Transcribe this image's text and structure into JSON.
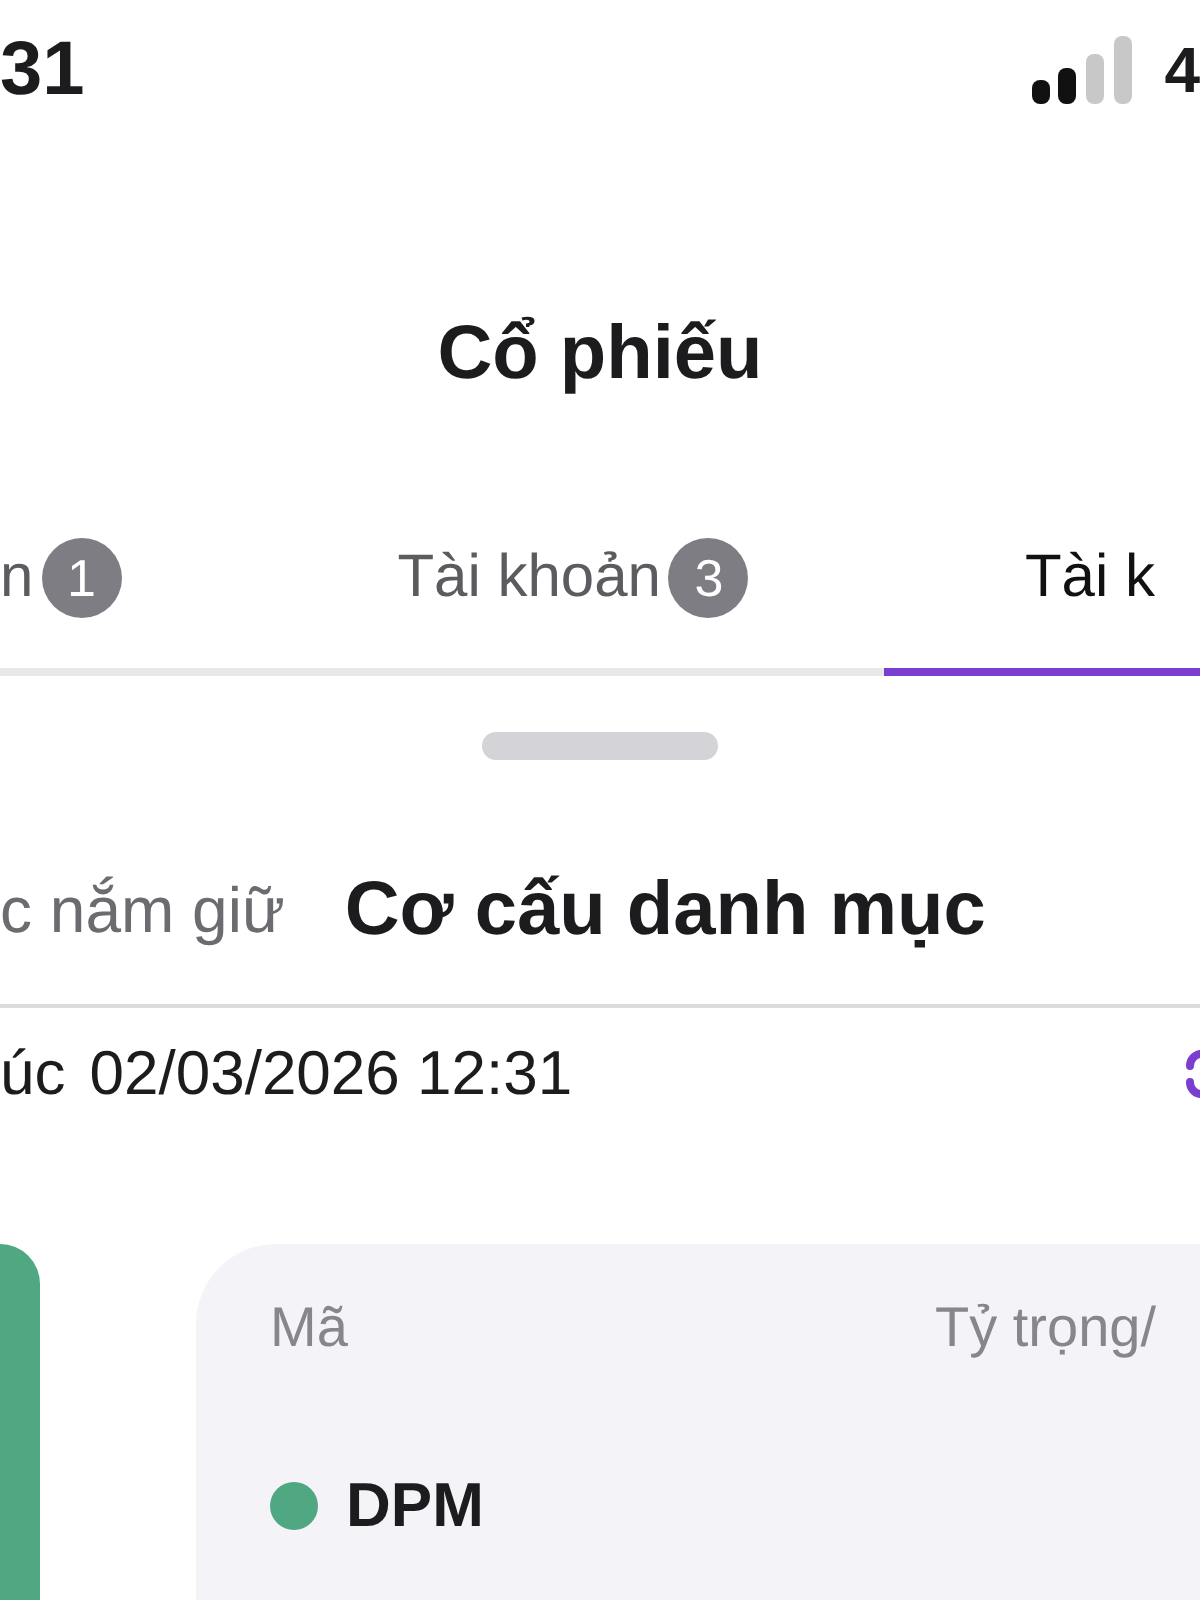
{
  "status_bar": {
    "time": "31",
    "battery": "4"
  },
  "title": "Cổ phiếu",
  "tabs": [
    {
      "label": "n",
      "badge": "1",
      "selected": false
    },
    {
      "label": "Tài khoản",
      "badge": "3",
      "selected": false
    },
    {
      "label": "Tài k",
      "selected": true
    }
  ],
  "segments": [
    {
      "label": "c nắm giữ",
      "selected": false
    },
    {
      "label": "Cơ cấu danh mục",
      "selected": true
    }
  ],
  "updated": {
    "label": "úc",
    "value": "02/03/2026 12:31"
  },
  "table": {
    "columns": [
      "Mã",
      "Tỷ trọng/"
    ],
    "rows": [
      {
        "symbol": "DPM",
        "color": "#4fa882"
      }
    ]
  }
}
